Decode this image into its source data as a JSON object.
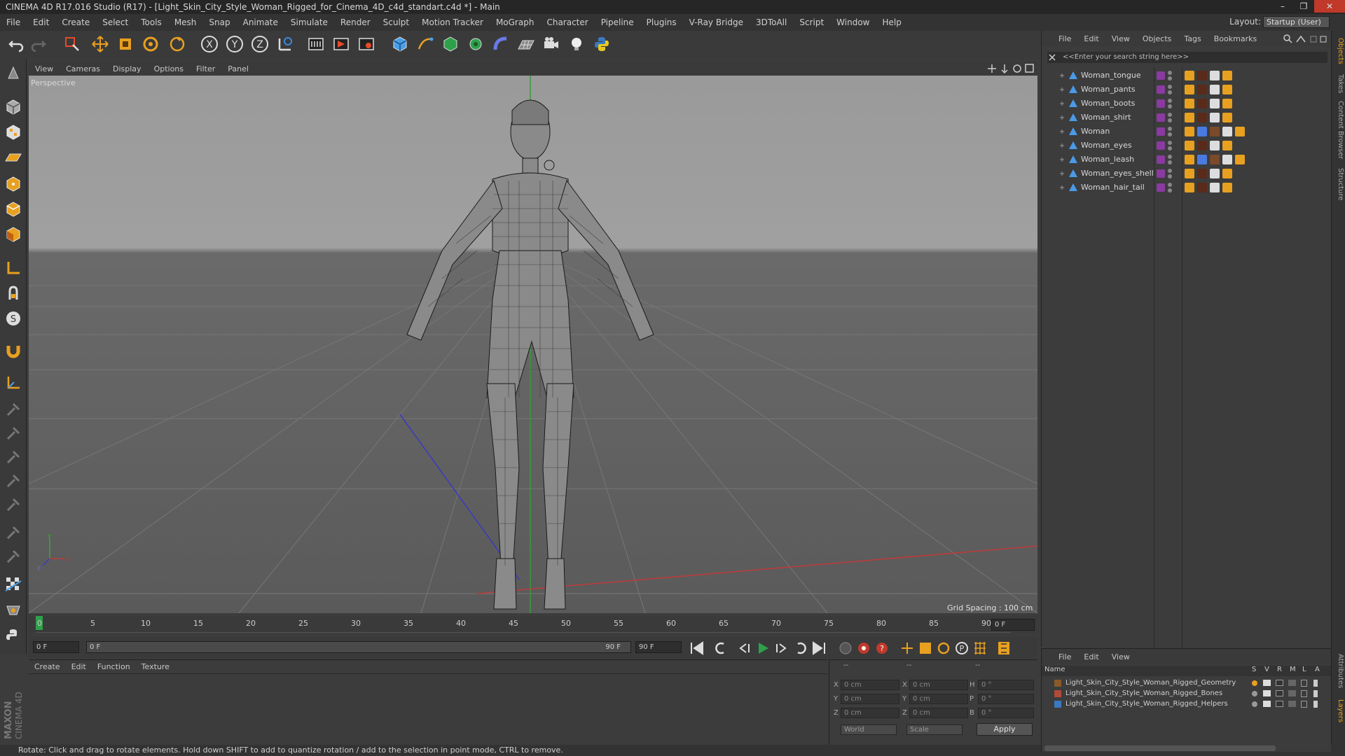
{
  "window": {
    "title": "CINEMA 4D R17.016 Studio (R17) - [Light_Skin_City_Style_Woman_Rigged_for_Cinema_4D_c4d_standart.c4d *] - Main",
    "controls": [
      "–",
      "❐",
      "✕"
    ]
  },
  "menubar": [
    "File",
    "Edit",
    "Create",
    "Select",
    "Tools",
    "Mesh",
    "Snap",
    "Animate",
    "Simulate",
    "Render",
    "Sculpt",
    "Motion Tracker",
    "MoGraph",
    "Character",
    "Pipeline",
    "Plugins",
    "V-Ray Bridge",
    "3DToAll",
    "Script",
    "Window",
    "Help"
  ],
  "layout": {
    "label": "Layout:",
    "value": "Startup (User)"
  },
  "viewport": {
    "menu": [
      "View",
      "Cameras",
      "Display",
      "Options",
      "Filter",
      "Panel"
    ],
    "label": "Perspective",
    "grid_spacing": "Grid Spacing : 100 cm"
  },
  "timeline": {
    "ticks": [
      "0",
      "5",
      "10",
      "15",
      "20",
      "25",
      "30",
      "35",
      "40",
      "45",
      "50",
      "55",
      "60",
      "65",
      "70",
      "75",
      "80",
      "85",
      "90"
    ],
    "current_frame": "0 F",
    "start_frame": "0 F",
    "range_start": "0 F",
    "range_end": "90 F",
    "end_frame": "90 F"
  },
  "material_panel": {
    "menu": [
      "Create",
      "Edit",
      "Function",
      "Texture"
    ]
  },
  "coord_panel": {
    "headers": [
      "--",
      "--",
      "--"
    ],
    "rows": [
      {
        "axis": "X",
        "pos": "0 cm",
        "size_axis": "X",
        "size": "0 cm",
        "rot_axis": "H",
        "rot": "0 °"
      },
      {
        "axis": "Y",
        "pos": "0 cm",
        "size_axis": "Y",
        "size": "0 cm",
        "rot_axis": "P",
        "rot": "0 °"
      },
      {
        "axis": "Z",
        "pos": "0 cm",
        "size_axis": "Z",
        "size": "0 cm",
        "rot_axis": "B",
        "rot": "0 °"
      }
    ],
    "mode": "World",
    "scale": "Scale",
    "apply": "Apply"
  },
  "object_panel": {
    "menu": [
      "File",
      "Edit",
      "View",
      "Objects",
      "Tags",
      "Bookmarks"
    ],
    "search_placeholder": "<<Enter your search string here>>",
    "objects": [
      "Woman_tongue",
      "Woman_pants",
      "Woman_boots",
      "Woman_shirt",
      "Woman",
      "Woman_eyes",
      "Woman_leash",
      "Woman_eyes_shell",
      "Woman_hair_tail"
    ]
  },
  "layer_panel": {
    "menu": [
      "File",
      "Edit",
      "View"
    ],
    "columns": [
      "Name",
      "S",
      "V",
      "R",
      "M",
      "L",
      "A"
    ],
    "layers": [
      {
        "name": "Light_Skin_City_Style_Woman_Rigged_Geometry",
        "color": "#8a5a2a"
      },
      {
        "name": "Light_Skin_City_Style_Woman_Rigged_Bones",
        "color": "#b04a3a"
      },
      {
        "name": "Light_Skin_City_Style_Woman_Rigged_Helpers",
        "color": "#3a7ac0"
      }
    ]
  },
  "side_tabs": [
    "Objects",
    "Takes",
    "Content Browser",
    "Structure",
    "Attributes",
    "Layers"
  ],
  "status": "Rotate: Click and drag to rotate elements. Hold down SHIFT to add to quantize rotation / add to the selection in point mode, CTRL to remove.",
  "colors": {
    "accent_orange": "#e8a020",
    "bg": "#3c3c3c",
    "viewport": "#5a5a5a"
  }
}
